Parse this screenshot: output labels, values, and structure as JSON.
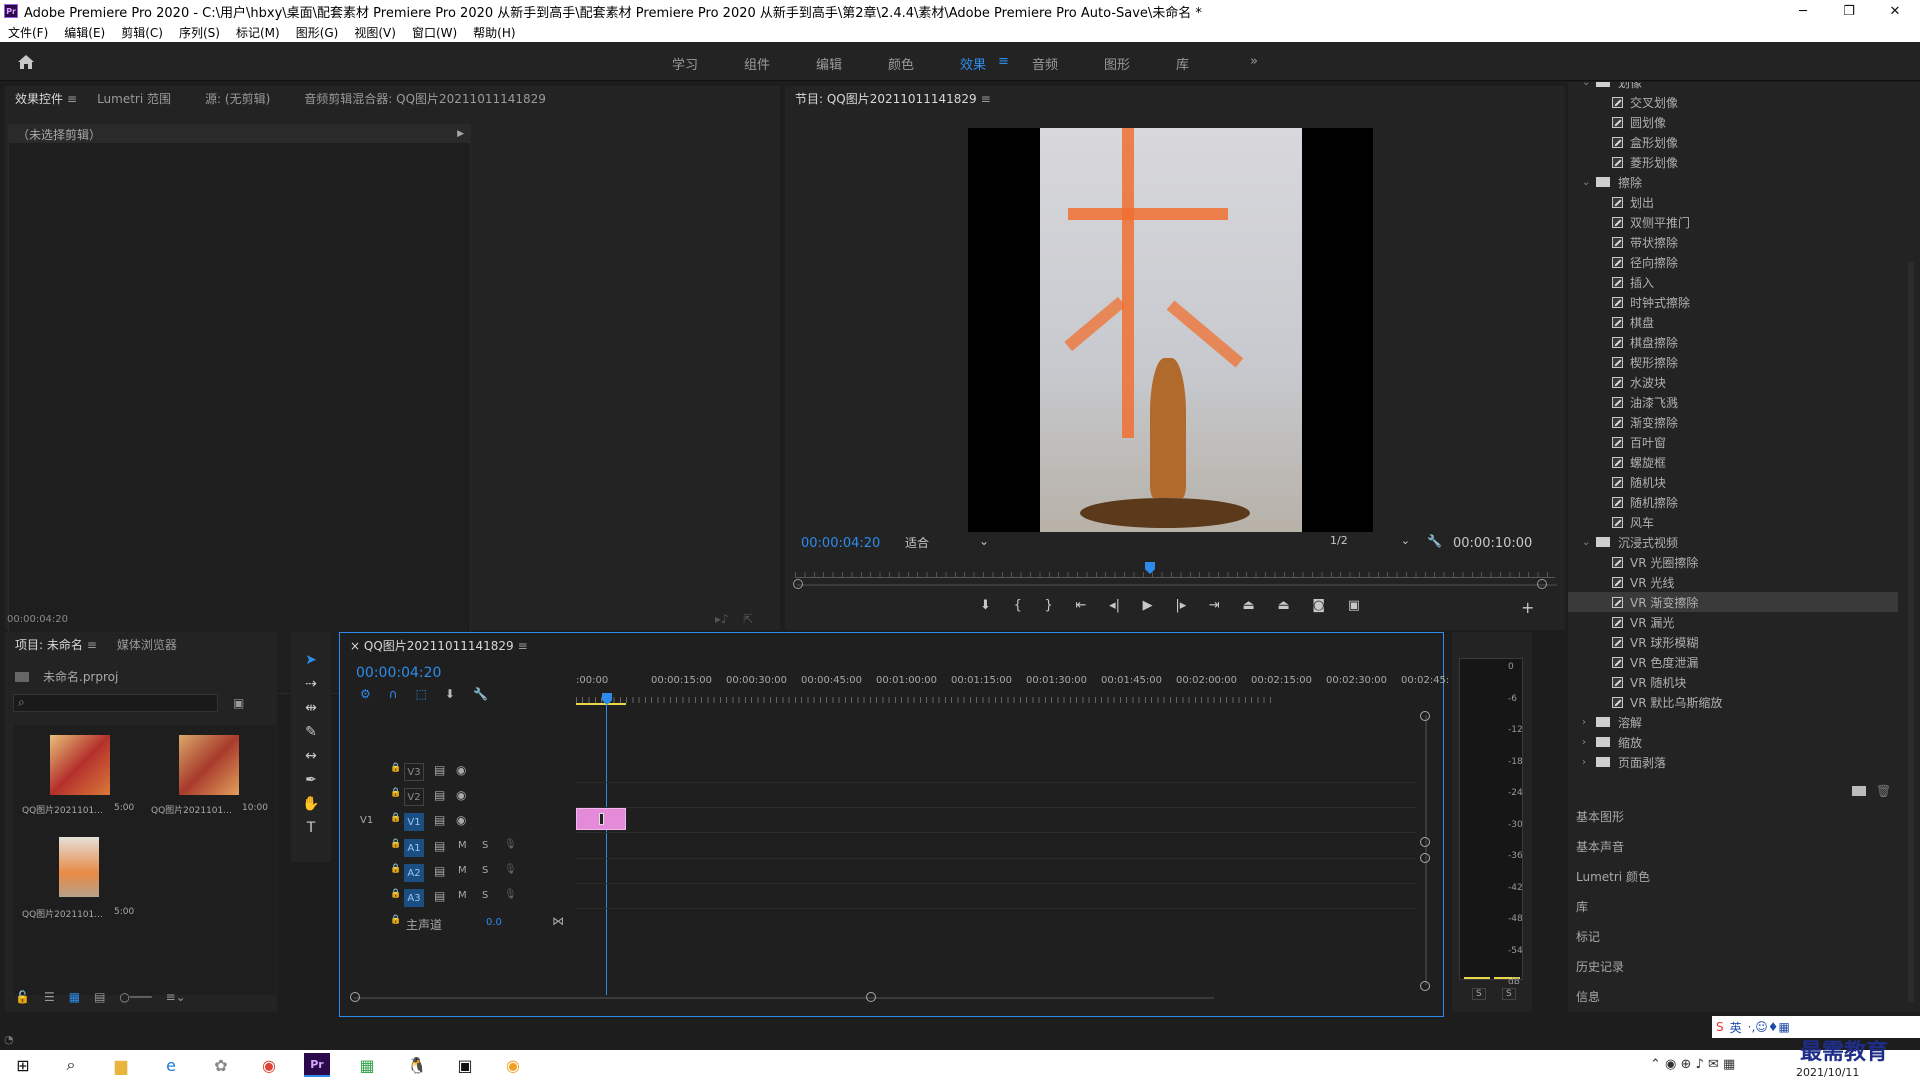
{
  "window": {
    "title": "Adobe Premiere Pro 2020 - C:\\用户\\hbxy\\桌面\\配套素材 Premiere Pro 2020 从新手到高手\\配套素材 Premiere Pro 2020 从新手到高手\\第2章\\2.4.4\\素材\\Adobe Premiere Pro Auto-Save\\未命名 *",
    "logo": "Pr"
  },
  "menu": [
    "文件(F)",
    "编辑(E)",
    "剪辑(C)",
    "序列(S)",
    "标记(M)",
    "图形(G)",
    "视图(V)",
    "窗口(W)",
    "帮助(H)"
  ],
  "workspaces": [
    "学习",
    "组件",
    "编辑",
    "颜色",
    "效果",
    "音频",
    "图形",
    "库"
  ],
  "workspaces_more": "»",
  "effects_panel": {
    "tabs": [
      "效果控件",
      "Lumetri 范围",
      "源: (无剪辑)",
      "音频剪辑混合器: QQ图片20211011141829"
    ],
    "no_clip": "（未选择剪辑）",
    "timecode": "00:00:04:20"
  },
  "program": {
    "title": "节目: QQ图片20211011141829",
    "timecode": "00:00:04:20",
    "fit": "适合",
    "resolution": "1/2",
    "duration": "00:00:10:00"
  },
  "effects_tree": [
    {
      "type": "folder",
      "label": "划像",
      "level": 0,
      "expanded": true
    },
    {
      "type": "item",
      "label": "交叉划像"
    },
    {
      "type": "item",
      "label": "圆划像"
    },
    {
      "type": "item",
      "label": "盒形划像"
    },
    {
      "type": "item",
      "label": "菱形划像"
    },
    {
      "type": "folder",
      "label": "擦除",
      "expanded": true
    },
    {
      "type": "item",
      "label": "划出"
    },
    {
      "type": "item",
      "label": "双侧平推门"
    },
    {
      "type": "item",
      "label": "带状擦除"
    },
    {
      "type": "item",
      "label": "径向擦除"
    },
    {
      "type": "item",
      "label": "插入"
    },
    {
      "type": "item",
      "label": "时钟式擦除"
    },
    {
      "type": "item",
      "label": "棋盘"
    },
    {
      "type": "item",
      "label": "棋盘擦除"
    },
    {
      "type": "item",
      "label": "楔形擦除"
    },
    {
      "type": "item",
      "label": "水波块"
    },
    {
      "type": "item",
      "label": "油漆飞溅"
    },
    {
      "type": "item",
      "label": "渐变擦除"
    },
    {
      "type": "item",
      "label": "百叶窗"
    },
    {
      "type": "item",
      "label": "螺旋框"
    },
    {
      "type": "item",
      "label": "随机块"
    },
    {
      "type": "item",
      "label": "随机擦除"
    },
    {
      "type": "item",
      "label": "风车"
    },
    {
      "type": "folder",
      "label": "沉浸式视频",
      "expanded": true
    },
    {
      "type": "item",
      "label": "VR 光圈擦除"
    },
    {
      "type": "item",
      "label": "VR 光线"
    },
    {
      "type": "item",
      "label": "VR 渐变擦除",
      "selected": true
    },
    {
      "type": "item",
      "label": "VR 漏光"
    },
    {
      "type": "item",
      "label": "VR 球形模糊"
    },
    {
      "type": "item",
      "label": "VR 色度泄漏"
    },
    {
      "type": "item",
      "label": "VR 随机块"
    },
    {
      "type": "item",
      "label": "VR 默比乌斯缩放"
    },
    {
      "type": "folder",
      "label": "溶解",
      "expanded": false
    },
    {
      "type": "folder",
      "label": "缩放",
      "expanded": false
    },
    {
      "type": "folder",
      "label": "页面剥落",
      "expanded": false
    }
  ],
  "side_panels": [
    "基本图形",
    "基本声音",
    "Lumetri 颜色",
    "库",
    "标记",
    "历史记录",
    "信息"
  ],
  "project": {
    "tabs": [
      "项目: 未命名",
      "媒体浏览器"
    ],
    "file": "未命名.prproj",
    "clips": [
      {
        "name": "QQ图片2021101...",
        "dur": "5:00"
      },
      {
        "name": "QQ图片2021101...",
        "dur": "10:00"
      },
      {
        "name": "QQ图片2021101...",
        "dur": "5:00"
      }
    ]
  },
  "timeline": {
    "title": "QQ图片20211011141829",
    "timecode": "00:00:04:20",
    "ruler": [
      ":00:00",
      "00:00:15:00",
      "00:00:30:00",
      "00:00:45:00",
      "00:01:00:00",
      "00:01:15:00",
      "00:01:30:00",
      "00:01:45:00",
      "00:02:00:00",
      "00:02:15:00",
      "00:02:30:00",
      "00:02:45:"
    ],
    "video_tracks": [
      "V3",
      "V2",
      "V1"
    ],
    "audio_tracks": [
      "A1",
      "A2",
      "A3"
    ],
    "v1_source": "V1",
    "master": "主声道",
    "master_value": "0.0",
    "m": "M",
    "s": "S"
  },
  "meter": {
    "scale": [
      "0",
      "-6",
      "-12",
      "-18",
      "-24",
      "-30",
      "-36",
      "-42",
      "-48",
      "-54",
      "dB"
    ],
    "solo": [
      "S",
      "S"
    ]
  },
  "taskbar": {
    "date": "2021/10/11",
    "ime": "英",
    "watermark": "最需教育"
  }
}
